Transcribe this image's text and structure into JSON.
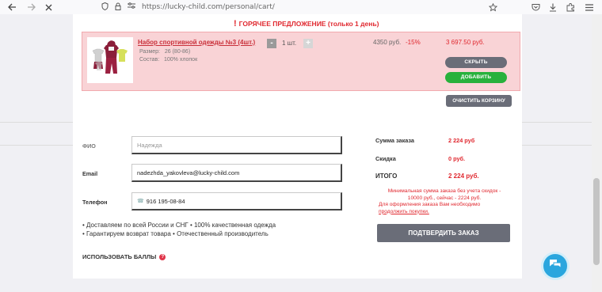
{
  "browser": {
    "url": "https://lucky-child.com/personal/cart/",
    "icons": [
      "back-arrow-icon",
      "forward-arrow-icon",
      "stop-icon",
      "shield-icon",
      "lock-icon",
      "permissions-icon",
      "bookmark-star-icon",
      "pocket-icon",
      "downloads-icon",
      "extensions-icon",
      "menu-icon"
    ]
  },
  "hot_offer": {
    "title": "ГОРЯЧЕЕ ПРЕДЛОЖЕНИЕ (только 1 день)",
    "exclamation": "!",
    "product": {
      "name": "Набор спортивной одежды №3 (4шт.)",
      "size_label": "Размер:",
      "size_value": "26 (80-86)",
      "composition_label": "Состав:",
      "composition_value": "100% хлопок",
      "qty_minus": "-",
      "qty_plus": "+",
      "quantity": "1 шт.",
      "old_price": "4350 руб.",
      "discount": "-15%",
      "new_price": "3 697.50 руб."
    },
    "hide_button": "СКРЫТЬ",
    "add_button": "ДОБАВИТЬ"
  },
  "clear_cart_button": "ОЧИСТИТЬ КОРЗИНУ",
  "form": {
    "fio_label": "ФИО",
    "fio_placeholder": "Надежда",
    "email_label": "Email",
    "email_value": "nadezhda_yakovleva@lucky-child.com",
    "phone_label": "Телефон",
    "phone_value": "916 195-08-84"
  },
  "features": {
    "line1": "• Доставляем по всей России и СНГ • 100% качественная одежда",
    "line2": "• Гарантируем возврат товара • Отечественный производитель"
  },
  "use_points": {
    "label": "ИСПОЛЬЗОВАТЬ БАЛЛЫ",
    "help": "?"
  },
  "summary": {
    "sum_label": "Сумма заказа",
    "sum_value": "2 224 руб",
    "discount_label": "Скидка",
    "discount_value": "0 руб.",
    "total_label": "ИТОГО",
    "total_value": "2 224 руб.",
    "min_note_line1": "Минимальная сумма заказа без учета скидок -",
    "min_note_line2": "10000 руб., сейчас - 2224 руб.",
    "min_note_line3": "Для оформления заказа Вам необходимо",
    "min_note_link": "продолжить покупки.",
    "confirm_button": "ПОДТВЕРДИТЬ ЗАКАЗ"
  },
  "colors": {
    "accent_red": "#e0282f",
    "offer_bg": "#f9d3d6",
    "green": "#28b13c",
    "gray_button": "#6a6d78",
    "chat_blue": "#2aa6de"
  }
}
